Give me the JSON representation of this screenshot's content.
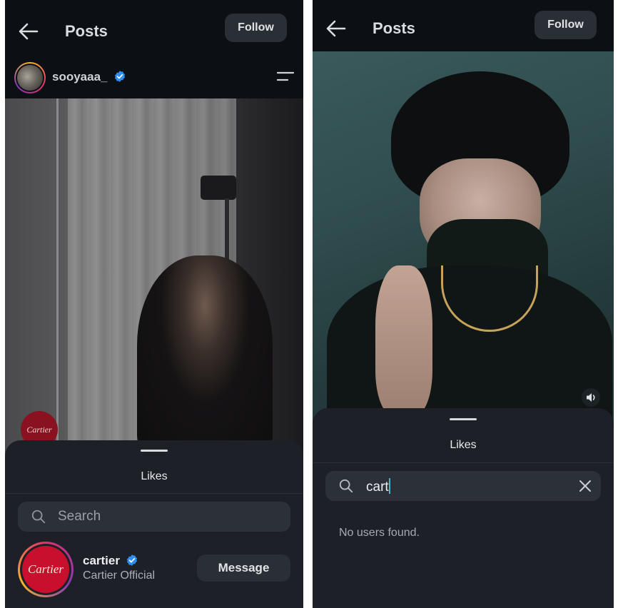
{
  "left": {
    "header": {
      "title": "Posts",
      "follow_label": "Follow"
    },
    "post": {
      "username": "sooyaaa_",
      "watermark_logo_text": "Cartier"
    },
    "likes_sheet": {
      "title": "Likes",
      "search_placeholder": "Search",
      "user": {
        "username": "cartier",
        "full_name": "Cartier Official",
        "logo_text": "Cartier",
        "action_label": "Message"
      }
    }
  },
  "right": {
    "header": {
      "title": "Posts",
      "follow_label": "Follow"
    },
    "likes_sheet": {
      "title": "Likes",
      "search_value": "cart",
      "empty_message": "No users found."
    }
  },
  "colors": {
    "background": "#0c0f13",
    "sheet": "#1d2026",
    "search_field": "#2c3038",
    "button": "#2a2f36",
    "verified_badge": "#2f8ef5",
    "story_ring": [
      "#f7b52c",
      "#e1306c",
      "#833ab4"
    ],
    "cartier_red": "#c8102e"
  },
  "icons": [
    "back-arrow-icon",
    "menu-icon",
    "verified-badge-icon",
    "search-icon",
    "clear-icon",
    "volume-icon"
  ]
}
